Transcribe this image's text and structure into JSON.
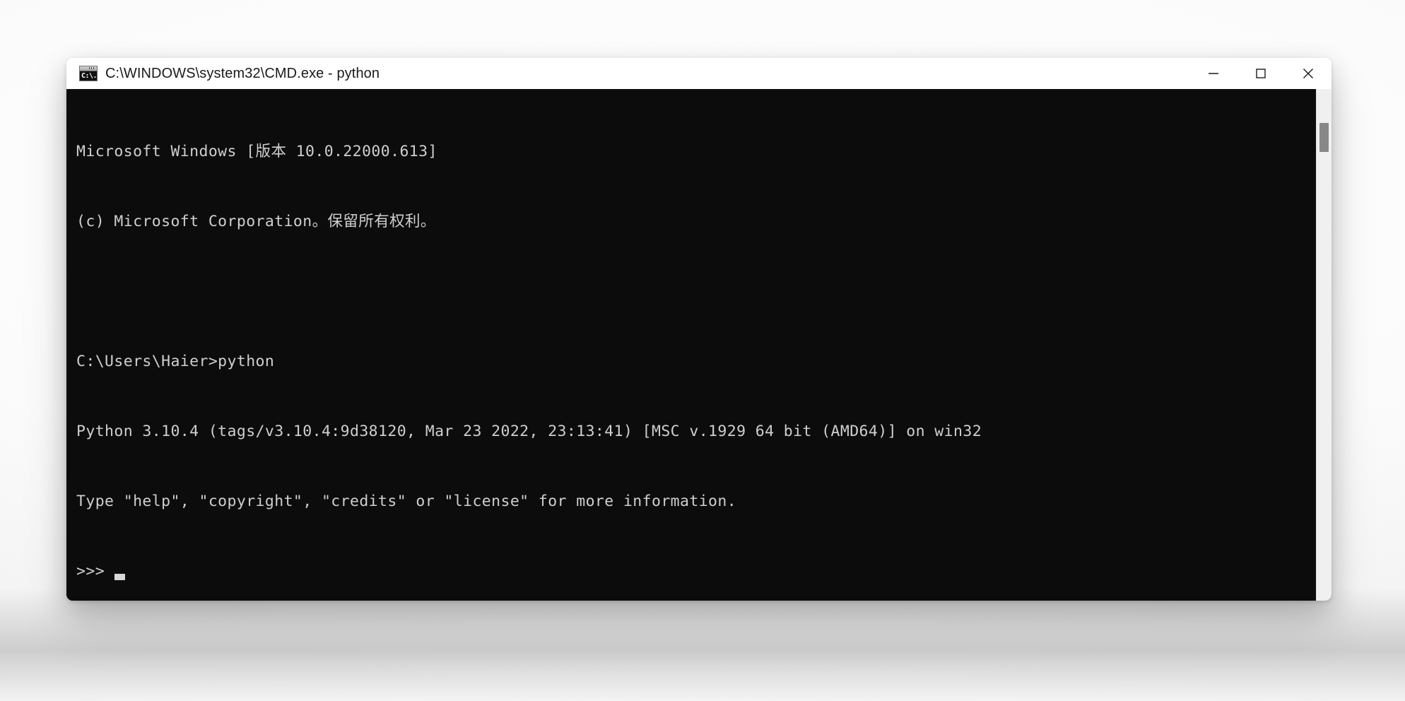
{
  "window": {
    "title": "C:\\WINDOWS\\system32\\CMD.exe - python",
    "icon_name": "cmd-console-icon",
    "icon_glyph": "C:\\.",
    "controls": {
      "minimize_label": "Minimize",
      "maximize_label": "Maximize",
      "close_label": "Close"
    },
    "colors": {
      "titlebar_bg": "#ffffff",
      "console_bg": "#0c0c0c",
      "console_text": "#cfcfcf",
      "scrollbar_track": "#f0f0f0",
      "scrollbar_thumb": "#878787"
    }
  },
  "console": {
    "lines": [
      "Microsoft Windows [版本 10.0.22000.613]",
      "(c) Microsoft Corporation。保留所有权利。",
      "",
      "C:\\Users\\Haier>python",
      "Python 3.10.4 (tags/v3.10.4:9d38120, Mar 23 2022, 23:13:41) [MSC v.1929 64 bit (AMD64)] on win32",
      "Type \"help\", \"copyright\", \"credits\" or \"license\" for more information."
    ],
    "prompt": ">>>",
    "cursor": "block"
  }
}
